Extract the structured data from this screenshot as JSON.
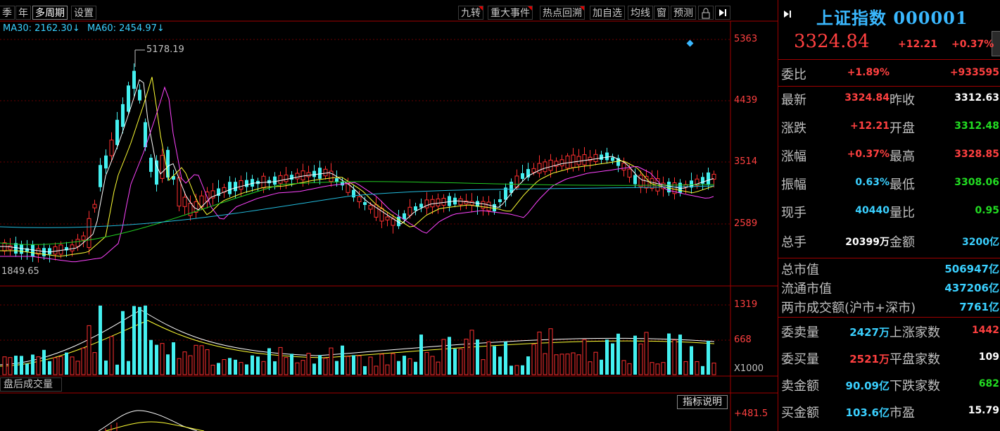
{
  "toolbar": {
    "left_items": [
      "季",
      "年",
      "多周期",
      "设置"
    ],
    "right_items": [
      "九转",
      "重大事件",
      "热点回溯",
      "加自选",
      "均线",
      "窗",
      "预测"
    ]
  },
  "ma": {
    "ma30": "MA30: 2162.30↓",
    "ma60": "MA60: 2454.97↓"
  },
  "price_axis": [
    "5363",
    "4439",
    "3514",
    "2589"
  ],
  "annotations": {
    "high": "5178.19",
    "low": "1849.65"
  },
  "volume_axis": [
    "1319",
    "668",
    "X1000"
  ],
  "bottom_bar": {
    "label": "盘后成交量",
    "indicator_button": "指标说明",
    "indicator_axis": "+481.5"
  },
  "index_info": {
    "title": "上证指数 000001",
    "price": "3324.84",
    "change": "+12.21",
    "pct": "+0.37%"
  },
  "quote_rows": [
    {
      "l1": "委比",
      "v1": "+1.89%",
      "c1": "red",
      "l2": "",
      "v2": "+933595",
      "c2": "red"
    },
    {
      "l1": "最新",
      "v1": "3324.84",
      "c1": "red",
      "l2": "昨收",
      "v2": "3312.63",
      "c2": "white"
    },
    {
      "l1": "涨跌",
      "v1": "+12.21",
      "c1": "red",
      "l2": "开盘",
      "v2": "3312.48",
      "c2": "green"
    },
    {
      "l1": "涨幅",
      "v1": "+0.37%",
      "c1": "red",
      "l2": "最高",
      "v2": "3328.85",
      "c2": "red"
    },
    {
      "l1": "振幅",
      "v1": "0.63%",
      "c1": "cyan",
      "l2": "最低",
      "v2": "3308.06",
      "c2": "green"
    },
    {
      "l1": "现手",
      "v1": "40440",
      "c1": "cyan",
      "l2": "量比",
      "v2": "0.95",
      "c2": "green"
    },
    {
      "l1": "总手",
      "v1": "20399万",
      "c1": "white",
      "l2": "金额",
      "v2": "3200亿",
      "c2": "cyan"
    }
  ],
  "market_rows": [
    {
      "l": "总市值",
      "v": "506947亿"
    },
    {
      "l": "流通市值",
      "v": "437206亿"
    },
    {
      "l": "两市成交额(沪市+深市)",
      "v": "7761亿"
    }
  ],
  "order_rows": [
    {
      "l1": "委卖量",
      "v1": "2427万",
      "c1": "cyan",
      "l2": "上涨家数",
      "v2": "1442",
      "c2": "red"
    },
    {
      "l1": "委买量",
      "v1": "2521万",
      "c1": "red",
      "l2": "平盘家数",
      "v2": "109",
      "c2": "white"
    },
    {
      "l1": "卖金额",
      "v1": "90.09亿",
      "c1": "cyan",
      "l2": "下跌家数",
      "v2": "682",
      "c2": "green"
    },
    {
      "l1": "买金额",
      "v1": "103.6亿",
      "c1": "cyan",
      "l2": "市盈",
      "v2": "15.79",
      "c2": "white"
    }
  ],
  "colors": {
    "up": "#ff3030",
    "down": "#44f0f0",
    "ma5": "#ffffff",
    "ma10": "#ffff33",
    "ma20": "#ff44ff",
    "ma30": "#22cc22",
    "ma60": "#22bbdd",
    "grid": "#a00000"
  }
}
